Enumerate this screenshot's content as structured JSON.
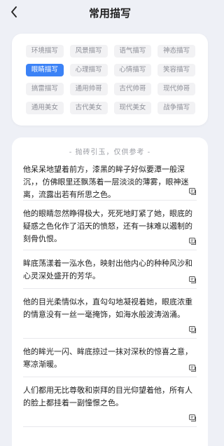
{
  "header": {
    "title": "常用描写"
  },
  "tags": [
    {
      "label": "环境描写",
      "active": false
    },
    {
      "label": "风景描写",
      "active": false
    },
    {
      "label": "语气描写",
      "active": false
    },
    {
      "label": "神态描写",
      "active": false
    },
    {
      "label": "眼睛描写",
      "active": true
    },
    {
      "label": "心理描写",
      "active": false
    },
    {
      "label": "心情描写",
      "active": false
    },
    {
      "label": "笑容描写",
      "active": false
    },
    {
      "label": "搞雷描写",
      "active": false
    },
    {
      "label": "通用帅哥",
      "active": false
    },
    {
      "label": "古代帅哥",
      "active": false
    },
    {
      "label": "现代帅哥",
      "active": false
    },
    {
      "label": "通用美女",
      "active": false
    },
    {
      "label": "古代美女",
      "active": false
    },
    {
      "label": "现代美女",
      "active": false
    },
    {
      "label": "战争描写",
      "active": false
    }
  ],
  "note": "- 抛砖引玉，仅供参考 -",
  "items": [
    {
      "text": "他呆呆地望着前方，漆黑的眸子好似要潭一般深沉，，仿佛眼里还飘荡着一层淡淡的薄雾，眼神迷离，流露出若有所思之色。"
    },
    {
      "text": "他的眼睛忽然睁得极大，死死地盯紧了她，眼底的疑惑之色化作了滔天的愤怒，还有一抹难以遏制的刻骨仇恨。"
    },
    {
      "text": "眸底荡漾着一泓水色，映射出他内心的种种风沙和心灵深处盛开的芳华。"
    },
    {
      "text": "他的目光柔情似水，直勾勾地凝视着她，眼底浓重的情意没有一丝一毫掩饰，如海水般波涛汹涌。"
    },
    {
      "text": "他的眸光一闪、眸底掠过一抹对深秋的惊喜之意，寒凉渐暖。"
    },
    {
      "text": "人们都用无比尊敬和崇拜的目光仰望着他，所有人的脸上都挂着一副憧憬之色。"
    }
  ]
}
